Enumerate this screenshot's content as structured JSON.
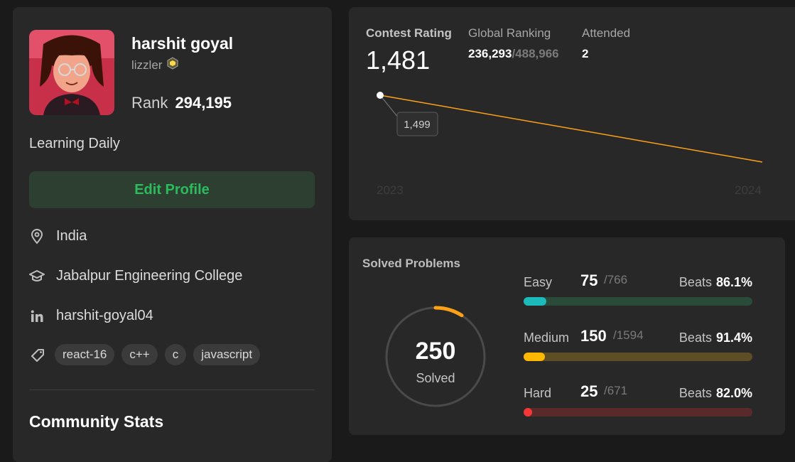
{
  "profile": {
    "name": "harshit goyal",
    "handle": "lizzler",
    "rank_label": "Rank",
    "rank_value": "294,195",
    "bio": "Learning Daily",
    "edit_label": "Edit Profile",
    "location": "India",
    "school": "Jabalpur Engineering College",
    "linkedin": "harshit-goyal04",
    "tags": [
      "react-16",
      "c++",
      "c",
      "javascript"
    ],
    "community_title": "Community Stats"
  },
  "contest": {
    "rating_label": "Contest Rating",
    "rating_value": "1,481",
    "global_label": "Global Ranking",
    "global_rank": "236,293",
    "global_total": "/488,966",
    "attended_label": "Attended",
    "attended_value": "2",
    "tooltip": "1,499",
    "x_start": "2023",
    "x_end": "2024",
    "line_color": "#ffa116"
  },
  "solved": {
    "title": "Solved Problems",
    "total": "250",
    "sub": "Solved",
    "beats_label": "Beats",
    "ring_fraction": 0.09,
    "difficulties": [
      {
        "name": "Easy",
        "solved": "75",
        "total": "/766",
        "beats": "86.1%",
        "fraction": 0.098,
        "fill": "#1cbaba",
        "track": "#2a4a3a"
      },
      {
        "name": "Medium",
        "solved": "150",
        "total": "/1594",
        "beats": "91.4%",
        "fraction": 0.094,
        "fill": "#ffb700",
        "track": "#5e4e26"
      },
      {
        "name": "Hard",
        "solved": "25",
        "total": "/671",
        "beats": "82.0%",
        "fraction": 0.037,
        "fill": "#f63737",
        "track": "#5a2a2a"
      }
    ]
  }
}
